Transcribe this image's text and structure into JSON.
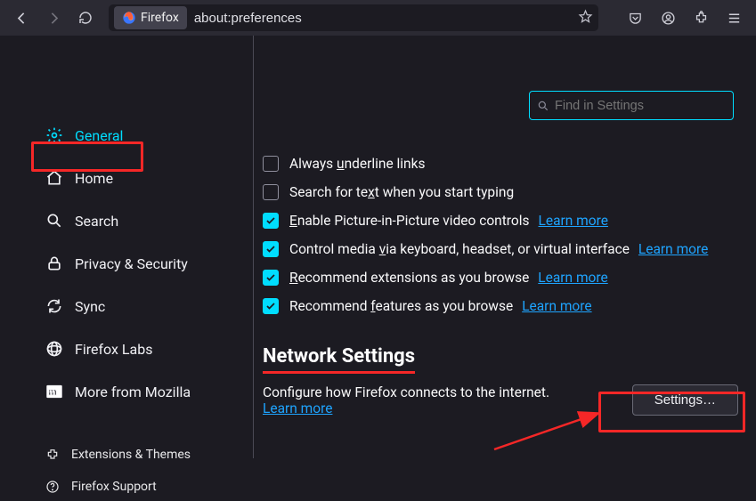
{
  "toolbar": {
    "identity_label": "Firefox",
    "url": "about:preferences"
  },
  "search": {
    "placeholder": "Find in Settings"
  },
  "sidebar": {
    "items": [
      {
        "label": "General"
      },
      {
        "label": "Home"
      },
      {
        "label": "Search"
      },
      {
        "label": "Privacy & Security"
      },
      {
        "label": "Sync"
      },
      {
        "label": "Firefox Labs"
      },
      {
        "label": "More from Mozilla"
      }
    ],
    "sub": [
      {
        "label": "Extensions & Themes"
      },
      {
        "label": "Firefox Support"
      }
    ]
  },
  "checkboxes": [
    {
      "pre": "Always ",
      "u": "u",
      "post": "nderline links",
      "checked": false,
      "learn": false
    },
    {
      "pre": "Search for te",
      "u": "x",
      "post": "t when you start typing",
      "checked": false,
      "learn": false
    },
    {
      "pre": "",
      "u": "E",
      "post": "nable Picture-in-Picture video controls",
      "checked": true,
      "learn": true
    },
    {
      "pre": "Control media ",
      "u": "v",
      "post": "ia keyboard, headset, or virtual interface",
      "checked": true,
      "learn": true
    },
    {
      "pre": "",
      "u": "R",
      "post": "ecommend extensions as you browse",
      "checked": true,
      "learn": true
    },
    {
      "pre": "Recommend ",
      "u": "f",
      "post": "eatures as you browse",
      "checked": true,
      "learn": true
    }
  ],
  "learn_label": "Learn more",
  "network": {
    "head": "Network Settings",
    "desc": "Configure how Firefox connects to the internet.",
    "learn": "Learn more",
    "btn": "Settings…"
  }
}
